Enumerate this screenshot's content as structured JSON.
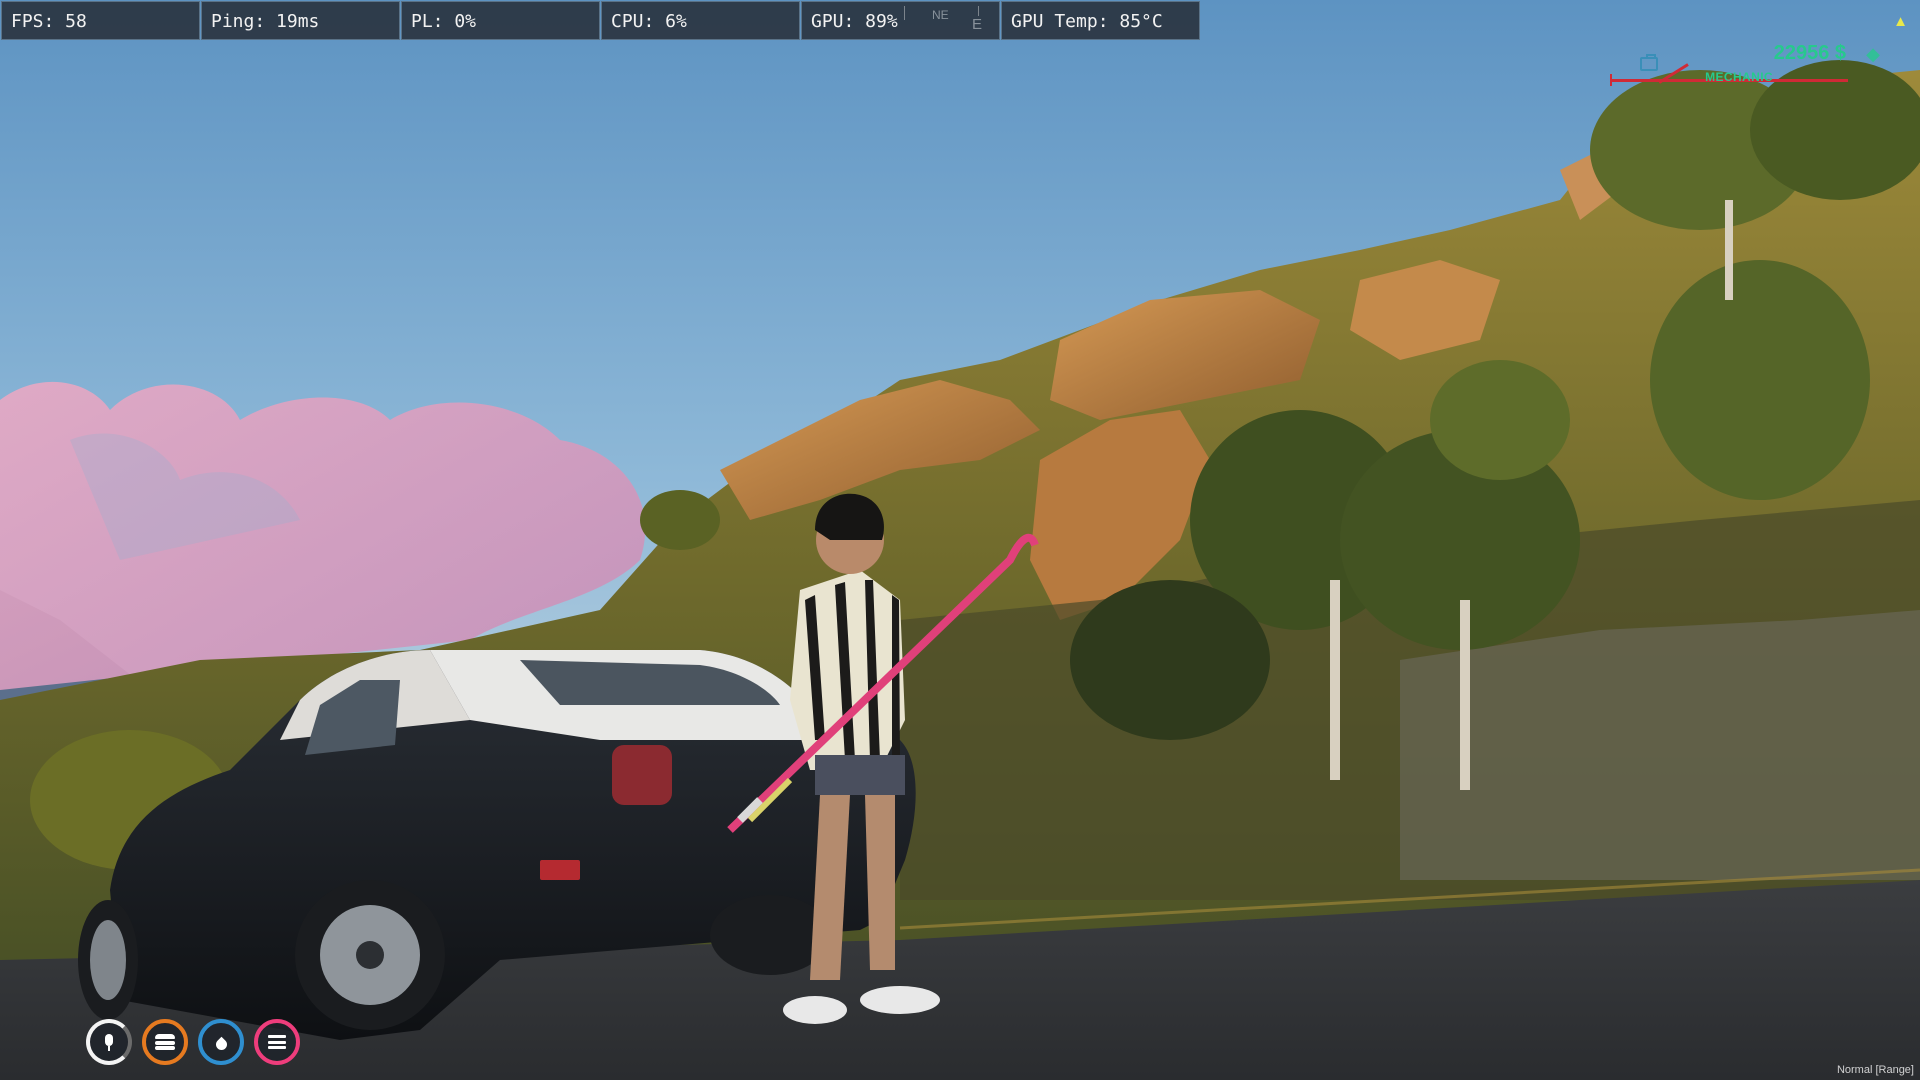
{
  "perf_overlay": {
    "fps": "FPS: 58",
    "ping": "Ping: 19ms",
    "pl": "PL: 0%",
    "cpu": "CPU: 6%",
    "gpu": "GPU: 89%",
    "gpu_temp": "GPU Temp: 85°C"
  },
  "compass": {
    "north_east": "NE",
    "east": "E"
  },
  "hud_top_right": {
    "money": "22956 $",
    "money_icon": "wallet-icon",
    "job": "MECHANIC",
    "job_icon": "briefcase-icon",
    "job_bar_color": "#d02a36",
    "money_color": "#27c98d"
  },
  "status": {
    "voice": {
      "icon": "microphone-icon",
      "color": "#f4f4f4"
    },
    "hunger": {
      "icon": "burger-icon",
      "color": "#e67a20"
    },
    "thirst": {
      "icon": "water-drop-icon",
      "color": "#2f8fd0"
    },
    "stress": {
      "icon": "menu-icon",
      "color": "#ee3d7c"
    }
  },
  "voice_mode": "Normal [Range]"
}
